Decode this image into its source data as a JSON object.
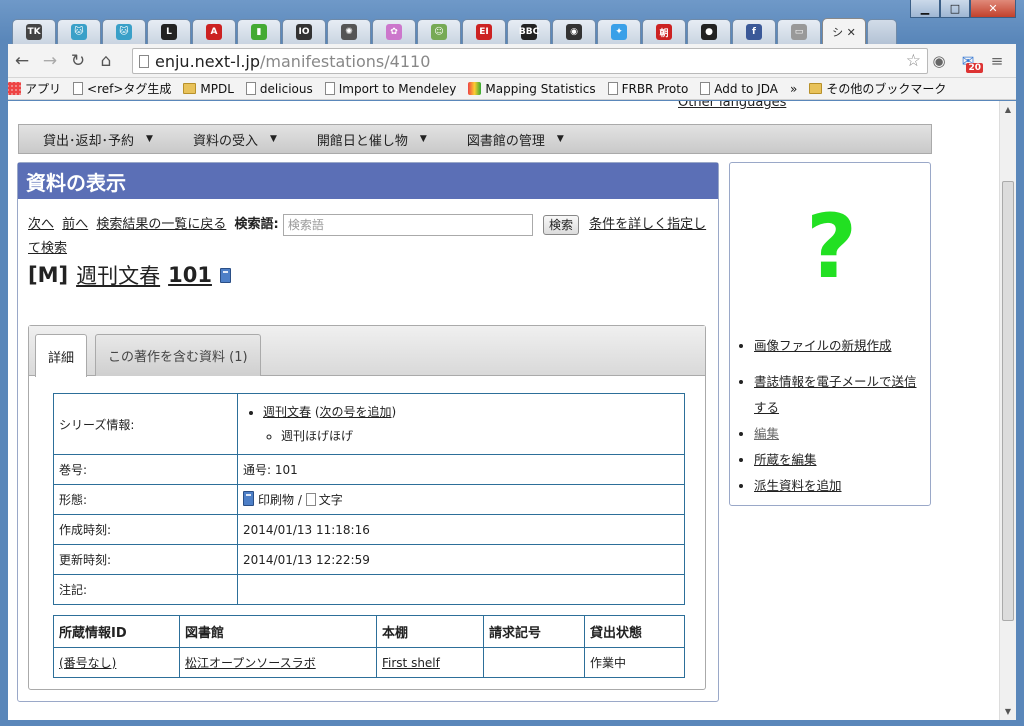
{
  "browser": {
    "tabs": [
      {
        "icon": "TK",
        "color": "#444"
      },
      {
        "icon": "cat",
        "color": "#3aa0c8"
      },
      {
        "icon": "cat",
        "color": "#3aa0c8"
      },
      {
        "icon": "L",
        "color": "#222"
      },
      {
        "icon": "A",
        "color": "#c22"
      },
      {
        "icon": "book",
        "color": "#4a3"
      },
      {
        "icon": "IO",
        "color": "#333"
      },
      {
        "icon": "atom",
        "color": "#555"
      },
      {
        "icon": "palette",
        "color": "#c7c"
      },
      {
        "icon": "face",
        "color": "#7a5"
      },
      {
        "icon": "EI",
        "color": "#c22"
      },
      {
        "icon": "BBC",
        "color": "#222"
      },
      {
        "icon": "circle",
        "color": "#333"
      },
      {
        "icon": "twitter",
        "color": "#3aa0e8"
      },
      {
        "icon": "朝",
        "color": "#c22"
      },
      {
        "icon": "github",
        "color": "#222"
      },
      {
        "icon": "f",
        "color": "#3b5998"
      },
      {
        "icon": "page",
        "color": "#999"
      }
    ],
    "active_tab_text": "シ",
    "url_host": "enju.next-l.jp",
    "url_path": "/manifestations/4110",
    "ext_badge": "20",
    "bookmarks": [
      {
        "label": "アプリ",
        "icon": "apps"
      },
      {
        "label": "<ref>タグ生成",
        "icon": "page"
      },
      {
        "label": "MPDL",
        "icon": "folder"
      },
      {
        "label": "delicious",
        "icon": "page"
      },
      {
        "label": "Import to Mendeley",
        "icon": "page"
      },
      {
        "label": "Mapping Statistics",
        "icon": "colored"
      },
      {
        "label": "FRBR Proto",
        "icon": "page"
      },
      {
        "label": "Add to JDA",
        "icon": "page"
      }
    ],
    "bookmarks_overflow": "»",
    "other_bookmarks": "その他のブックマーク"
  },
  "page": {
    "other_languages": "Other languages",
    "menu": [
      "貸出･返却･予約",
      "資料の受入",
      "開館日と催し物",
      "図書館の管理"
    ],
    "header": "資料の表示",
    "search": {
      "next": "次へ",
      "prev": "前へ",
      "back": "検索結果の一覧に戻る",
      "label": "検索語:",
      "placeholder": "検索語",
      "button": "検索",
      "advanced": "条件を詳しく指定して検索"
    },
    "title": {
      "bracket": "[M]",
      "name": "週刊文春",
      "volume": "101"
    },
    "tabs": [
      {
        "label": "詳細"
      },
      {
        "label": "この著作を含む資料 (1)"
      }
    ],
    "details": {
      "series_key": "シリーズ情報:",
      "series_link": "週刊文春",
      "series_add": "次の号を追加",
      "series_sub": "週刊ほげほげ",
      "issue_key": "巻号:",
      "issue_val": "通号: 101",
      "form_key": "形態:",
      "form_carrier": "印刷物",
      "form_sep": "/",
      "form_content": "文字",
      "created_key": "作成時刻:",
      "created_val": "2014/01/13 11:18:16",
      "updated_key": "更新時刻:",
      "updated_val": "2014/01/13 12:22:59",
      "note_key": "注記:",
      "note_val": ""
    },
    "holdings": {
      "headers": [
        "所蔵情報ID",
        "図書館",
        "本棚",
        "請求記号",
        "貸出状態"
      ],
      "rows": [
        {
          "id": "(番号なし)",
          "library": "松江オープンソースラボ",
          "shelf": "First shelf",
          "call": "",
          "status": "作業中"
        }
      ]
    },
    "sidebar": {
      "placeholder_glyph": "?",
      "links": [
        "画像ファイルの新規作成",
        "書誌情報を電子メールで送信する",
        "編集",
        "所蔵を編集",
        "派生資料を追加"
      ]
    }
  }
}
